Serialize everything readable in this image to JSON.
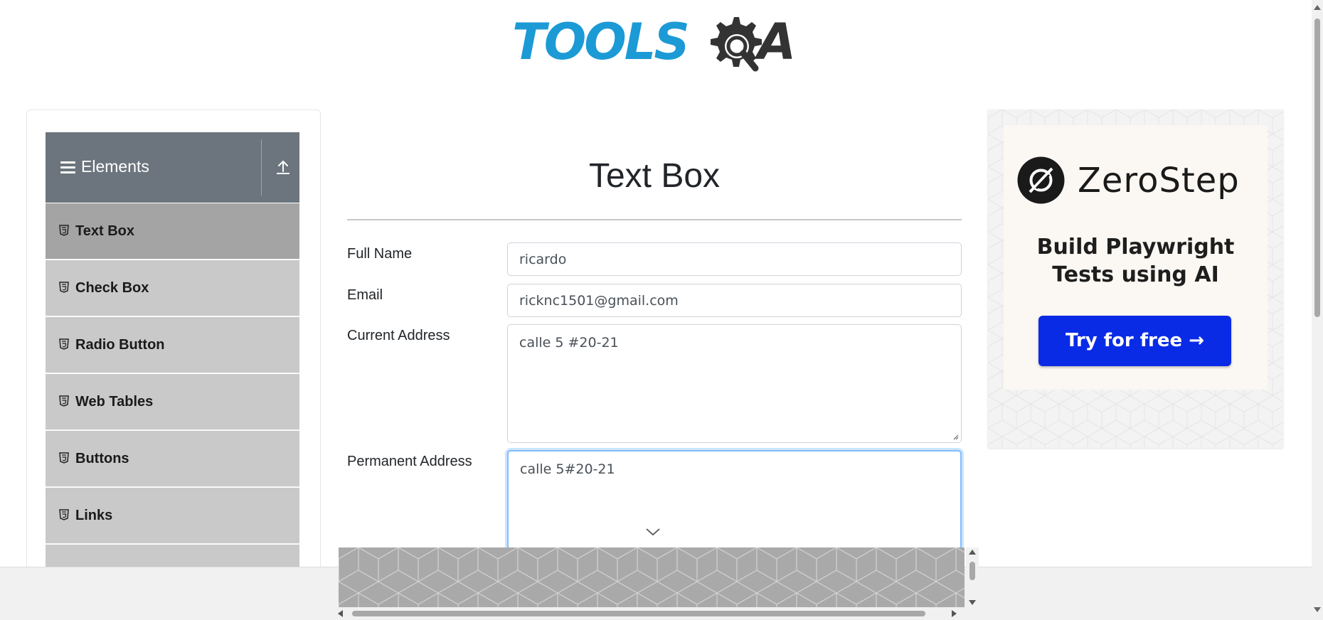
{
  "brand": {
    "logo_left": "TOOLS",
    "logo_right": "A"
  },
  "sidebar": {
    "group": {
      "title": "Elements"
    },
    "items": [
      {
        "label": "Text Box",
        "active": true
      },
      {
        "label": "Check Box",
        "active": false
      },
      {
        "label": "Radio Button",
        "active": false
      },
      {
        "label": "Web Tables",
        "active": false
      },
      {
        "label": "Buttons",
        "active": false
      },
      {
        "label": "Links",
        "active": false
      }
    ]
  },
  "main": {
    "title": "Text Box",
    "form": {
      "full_name": {
        "label": "Full Name",
        "value": "ricardo"
      },
      "email": {
        "label": "Email",
        "value": "ricknc1501@gmail.com"
      },
      "current_address": {
        "label": "Current Address",
        "value": "calle 5 #20-21"
      },
      "permanent_address": {
        "label": "Permanent Address",
        "value": "calle 5#20-21"
      }
    }
  },
  "ad": {
    "brand": "ZeroStep",
    "tagline_line1": "Build Playwright",
    "tagline_line2": "Tests using AI",
    "cta": "Try for free →",
    "cta_color": "#0a2be6"
  },
  "colors": {
    "logo_blue": "#1b9ad6",
    "logo_dark": "#333333",
    "group_header": "#6c757d",
    "menu_item": "#c9c9c9",
    "menu_item_active": "#a4a4a4",
    "focus_border": "#80bdff"
  }
}
